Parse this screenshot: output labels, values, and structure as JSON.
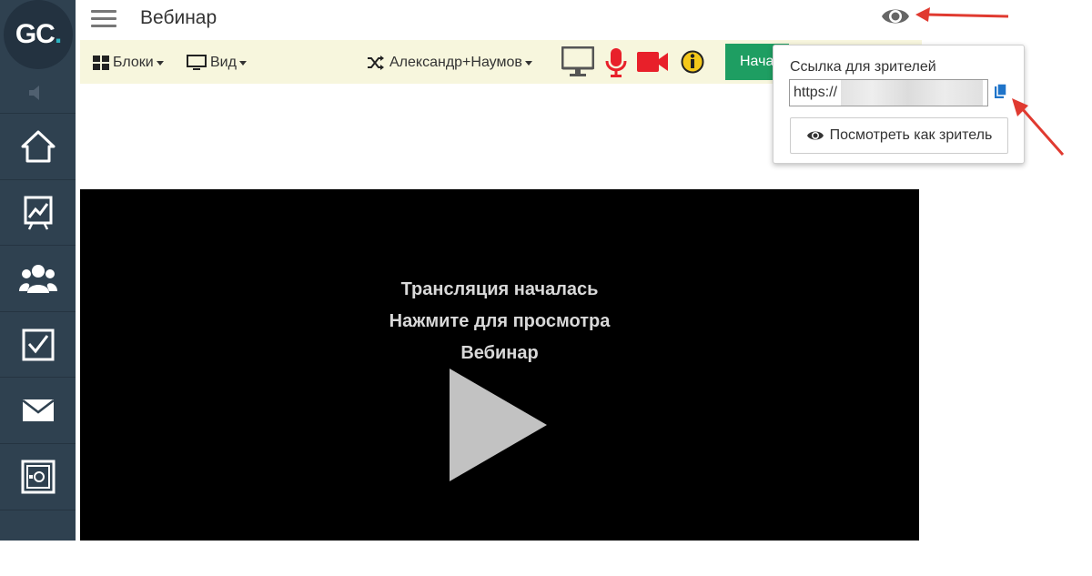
{
  "app": {
    "logo_text": "GC",
    "logo_dot": ".",
    "title": "Вебинар"
  },
  "sidebar": {
    "items": [
      {
        "icon": "home-icon"
      },
      {
        "icon": "chart-icon"
      },
      {
        "icon": "users-icon"
      },
      {
        "icon": "checkbox-icon"
      },
      {
        "icon": "mail-icon"
      },
      {
        "icon": "safe-icon"
      },
      {
        "icon": "device-icon"
      }
    ]
  },
  "toolbar": {
    "blocks_label": "Блоки",
    "view_label": "Вид",
    "user_label": "Александр+Наумов",
    "start_label": "Нача"
  },
  "video": {
    "line1": "Трансляция началась",
    "line2": "Нажмите для просмотра",
    "line3": "Вебинар"
  },
  "popover": {
    "label": "Ссылка для зрителей",
    "link_value": "https://",
    "view_button": "Посмотреть как зритель"
  },
  "colors": {
    "sidebar": "#2f4150",
    "toolbar": "#f7f6dd",
    "start_button": "#1e9e62",
    "mic_camera": "#e8202a",
    "arrow": "#e03a30",
    "copy_icon": "#1f74c9"
  }
}
